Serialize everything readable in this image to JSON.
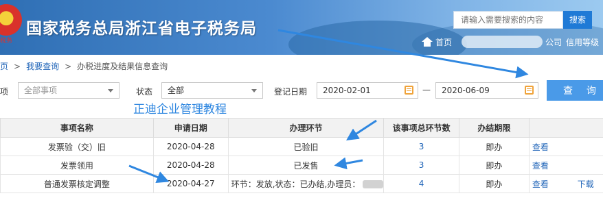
{
  "header": {
    "emblem_text": "税务",
    "site_title": "国家税务总局浙江省电子税务局",
    "search_placeholder": "请输入需要搜索的内容",
    "search_button": "搜索",
    "nav": {
      "home": "首页",
      "company_suffix": "公司",
      "credit": "信用等级"
    }
  },
  "breadcrumb": {
    "first": "页",
    "second": "我要查询",
    "current": "办税进度及结果信息查询"
  },
  "filters": {
    "item_label": "项",
    "item_value": "全部事项",
    "status_label": "状态",
    "status_value": "全部",
    "date_label": "登记日期",
    "date_from": "2020-02-01",
    "date_sep": "—",
    "date_to": "2020-06-09",
    "query_button": "查 询"
  },
  "watermark": "正迪企业管理教程",
  "table": {
    "headers": [
      "事项名称",
      "申请日期",
      "办理环节",
      "该事项总环节数",
      "办结期限",
      ""
    ],
    "rows": [
      {
        "name": "发票验（交）旧",
        "date": "2020-04-28",
        "stage": "已验旧",
        "steps": "3",
        "deadline": "即办",
        "view": "查看",
        "download": ""
      },
      {
        "name": "发票领用",
        "date": "2020-04-28",
        "stage": "已发售",
        "steps": "3",
        "deadline": "即办",
        "view": "查看",
        "download": ""
      },
      {
        "name": "普通发票核定调整",
        "date": "2020-04-27",
        "stage": "环节：发放,状态：已办结,办理员：",
        "steps": "4",
        "deadline": "即办",
        "view": "查看",
        "download": "下载"
      }
    ]
  },
  "colors": {
    "header_blue": "#2f6fb4",
    "link_blue": "#1f64b8",
    "arrow_blue": "#2f87e0",
    "query_button": "#4a9ae8"
  }
}
